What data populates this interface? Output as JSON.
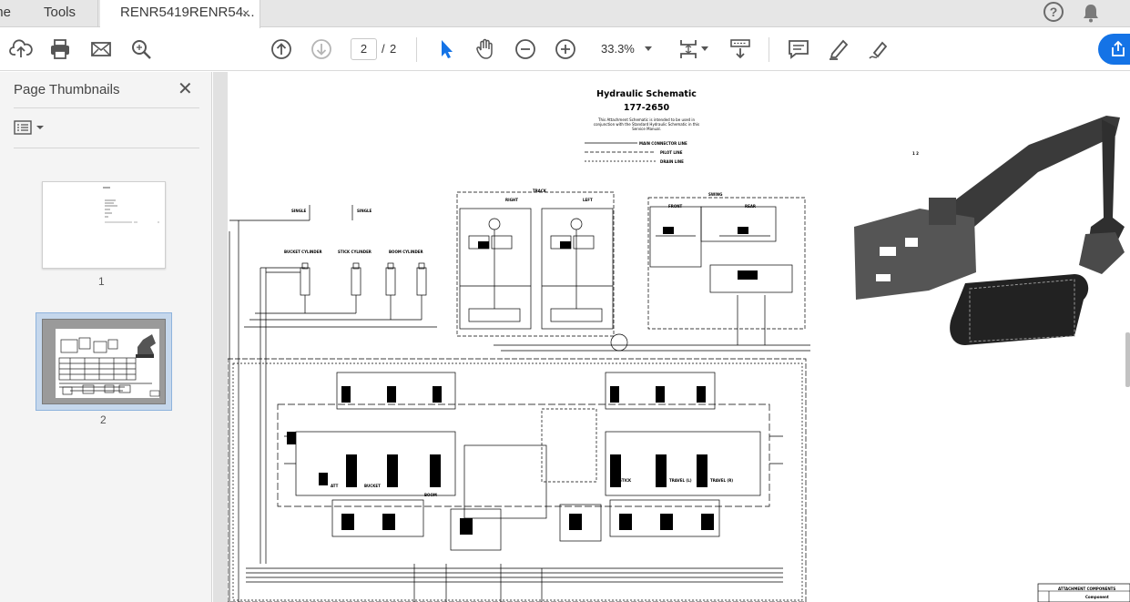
{
  "tabs": {
    "home_label": "Home",
    "tools_label": "Tools",
    "document_label": "RENR5419RENR54...",
    "close_glyph": "×"
  },
  "toolbar": {
    "current_page": "2",
    "page_separator": "/",
    "total_pages": "2",
    "zoom": "33.3%",
    "accent_color": "#1473e6"
  },
  "panel": {
    "title": "Page Thumbnails",
    "close_glyph": "✕",
    "thumbnails": [
      {
        "label": "1"
      },
      {
        "label": "2"
      }
    ]
  },
  "document": {
    "title": "Hydraulic Schematic",
    "subtitle": "177-2650",
    "note": "This Attachment Schematic is intended to be used in conjunction with the Standard Hydraulic Schematic in this Service Manual.",
    "legend": {
      "main": "MAIN CONNECTOR LINE",
      "pilot": "PILOT LINE",
      "drain": "DRAIN LINE"
    },
    "labels": {
      "single_1": "SINGLE",
      "single_2": "SINGLE",
      "bucket_cylinder": "BUCKET CYLINDER",
      "stick_cylinder": "STICK CYLINDER",
      "boom_cylinder": "BOOM CYLINDER",
      "track": "TRACK",
      "right": "RIGHT",
      "left": "LEFT",
      "swing": "SWING",
      "front": "FRONT",
      "rear": "REAR",
      "bucket": "BUCKET",
      "boom": "BOOM",
      "stick": "STICK",
      "travel_l": "TRAVEL (L)",
      "travel_r": "TRAVEL (R)",
      "att": "ATT",
      "callout": "1 2",
      "attachment_components": "ATTACHMENT COMPONENTS",
      "component": "Component"
    }
  }
}
